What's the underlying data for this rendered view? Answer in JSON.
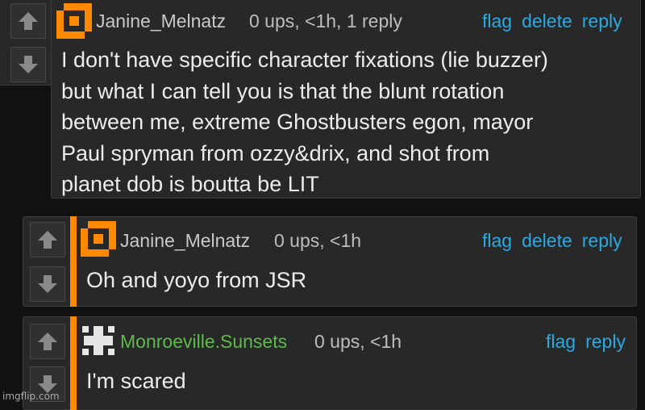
{
  "comments": [
    {
      "username": "Janine_Melnatz",
      "meta": "0 ups, <1h, 1 reply",
      "actions": [
        "flag",
        "delete",
        "reply"
      ],
      "text": "I don't have specific character fixations (lie buzzer)\nbut what I can tell you is that the blunt rotation\nbetween me, extreme Ghostbusters egon, mayor\nPaul spryman from ozzy&drix, and shot from\nplanet dob is boutta be LIT",
      "avatar_icon": "orange-square-avatar-icon"
    },
    {
      "username": "Janine_Melnatz",
      "meta": "0 ups, <1h",
      "actions": [
        "flag",
        "delete",
        "reply"
      ],
      "text": "Oh and yoyo from JSR",
      "avatar_icon": "orange-square-avatar-icon"
    },
    {
      "username": "Monroeville.Sunsets",
      "meta": "0 ups, <1h",
      "actions": [
        "flag",
        "reply"
      ],
      "text": "I'm scared",
      "avatar_icon": "white-cross-avatar-icon"
    }
  ],
  "icons": {
    "upvote": "arrow-up-icon",
    "downvote": "arrow-down-icon"
  },
  "colors": {
    "accent": "#ff8a00",
    "link": "#2aa9e2",
    "username_green": "#5dbb4a"
  },
  "watermark": "imgflip.com"
}
